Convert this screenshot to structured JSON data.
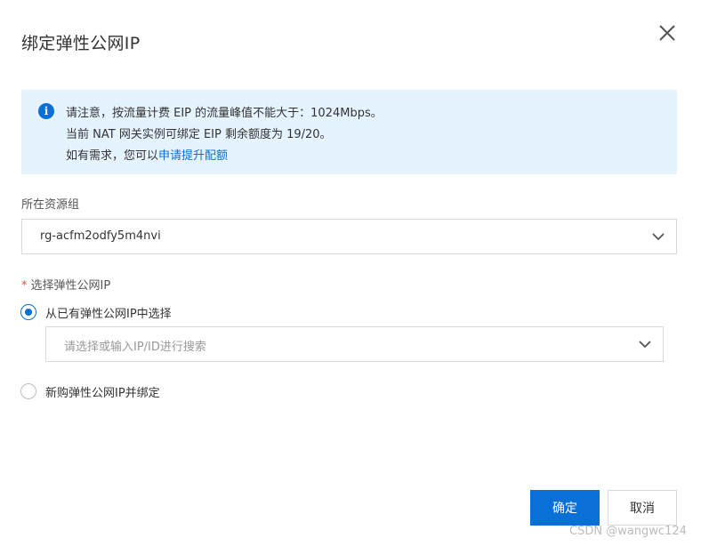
{
  "dialog": {
    "title": "绑定弹性公网IP",
    "close_icon": "close-icon"
  },
  "notice": {
    "icon": "info-icon",
    "icon_glyph": "i",
    "line1": "请注意，按流量计费 EIP 的流量峰值不能大于：1024Mbps。",
    "line2": "当前 NAT 网关实例可绑定 EIP 剩余额度为 19/20。",
    "line3_prefix": "如有需求，您可以",
    "line3_link": "申请提升配额",
    "background_color": "#e5f3ff",
    "link_color": "#0a6fd6"
  },
  "resource_group": {
    "label": "所在资源组",
    "value": "rg-acfm2odfy5m4nvi"
  },
  "eip": {
    "required_mark": "*",
    "label": "选择弹性公网IP",
    "options": [
      {
        "label": "从已有弹性公网IP中选择",
        "checked": true
      },
      {
        "label": "新购弹性公网IP并绑定",
        "checked": false
      }
    ],
    "search_placeholder": "请选择或输入IP/ID进行搜索"
  },
  "footer": {
    "confirm_label": "确定",
    "cancel_label": "取消",
    "primary_color": "#0a6fd6"
  },
  "watermark": "CSDN @wangwc124"
}
